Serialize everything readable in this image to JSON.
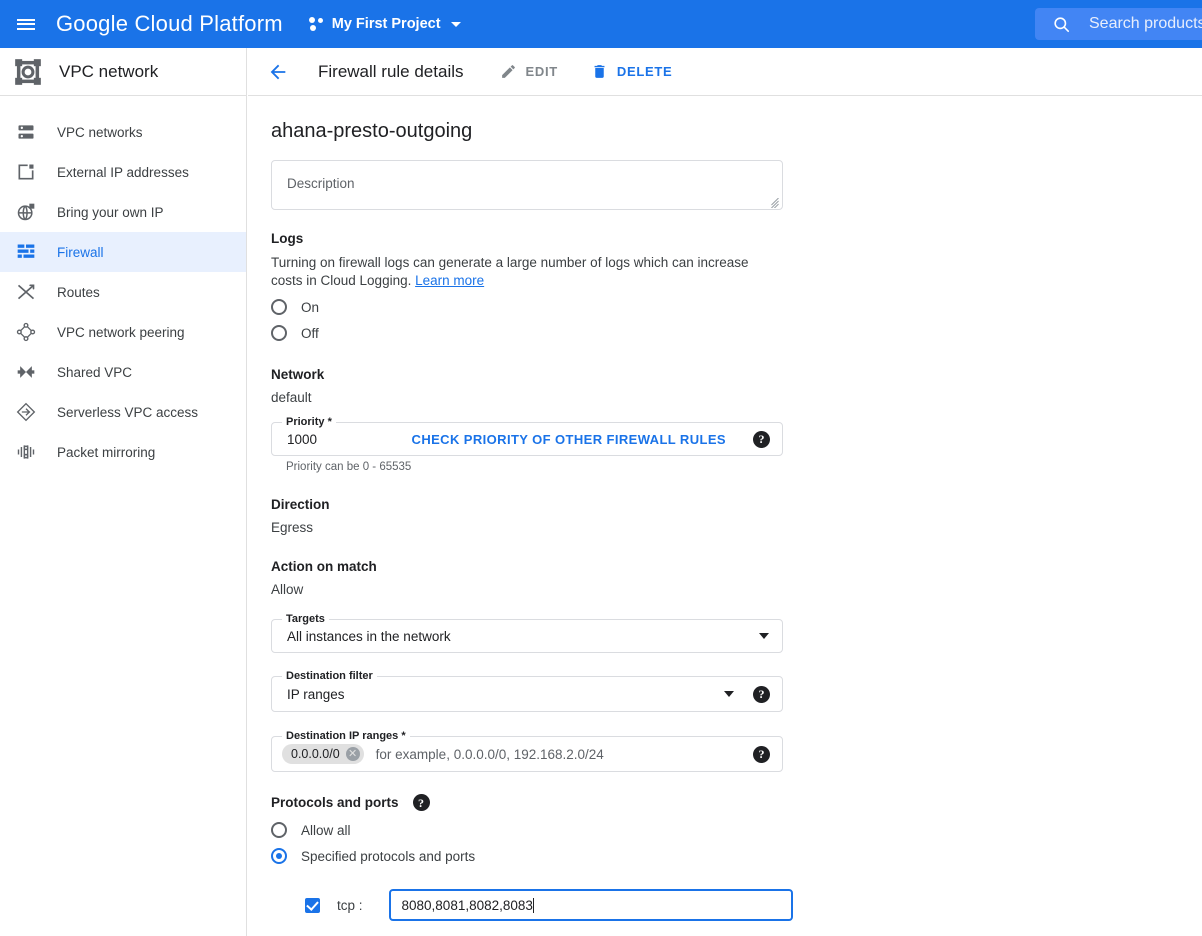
{
  "topbar": {
    "menu_icon": "hamburger-icon",
    "brand": "Google Cloud Platform",
    "project_icon": "project-dots-icon",
    "project_name": "My First Project",
    "project_caret": "chevron-down-icon",
    "search_icon": "search-icon",
    "search_placeholder": "Search products"
  },
  "sidebar": {
    "logo": "vpc-network-icon",
    "title": "VPC network",
    "items": [
      {
        "label": "VPC networks",
        "icon": "vpc-networks-icon",
        "active": false
      },
      {
        "label": "External IP addresses",
        "icon": "external-ip-icon",
        "active": false
      },
      {
        "label": "Bring your own IP",
        "icon": "bring-your-own-ip-icon",
        "active": false
      },
      {
        "label": "Firewall",
        "icon": "firewall-icon",
        "active": true
      },
      {
        "label": "Routes",
        "icon": "routes-icon",
        "active": false
      },
      {
        "label": "VPC network peering",
        "icon": "vpc-peering-icon",
        "active": false
      },
      {
        "label": "Shared VPC",
        "icon": "shared-vpc-icon",
        "active": false
      },
      {
        "label": "Serverless VPC access",
        "icon": "serverless-vpc-icon",
        "active": false
      },
      {
        "label": "Packet mirroring",
        "icon": "packet-mirroring-icon",
        "active": false
      }
    ]
  },
  "content_header": {
    "back_icon": "arrow-left-icon",
    "title": "Firewall rule details",
    "edit_icon": "pencil-icon",
    "edit_label": "EDIT",
    "delete_icon": "trash-icon",
    "delete_label": "DELETE"
  },
  "form": {
    "rule_name": "ahana-presto-outgoing",
    "description_placeholder": "Description",
    "logs": {
      "title": "Logs",
      "description_part1": "Turning on firewall logs can generate a large number of logs which can increase costs in Cloud Logging. ",
      "learn_more": "Learn more",
      "option_on": "On",
      "option_off": "Off",
      "selected": ""
    },
    "network": {
      "title": "Network",
      "value": "default"
    },
    "priority": {
      "legend": "Priority *",
      "value": "1000",
      "action_link": "CHECK PRIORITY OF OTHER FIREWALL RULES",
      "help_icon": "help-icon",
      "hint": "Priority can be 0 - 65535"
    },
    "direction": {
      "title": "Direction",
      "value": "Egress"
    },
    "action_on_match": {
      "title": "Action on match",
      "value": "Allow"
    },
    "targets": {
      "legend": "Targets",
      "value": "All instances in the network",
      "caret": "chevron-down-icon"
    },
    "destination_filter": {
      "legend": "Destination filter",
      "value": "IP ranges",
      "caret": "chevron-down-icon",
      "help_icon": "help-icon"
    },
    "destination_ip_ranges": {
      "legend": "Destination IP ranges *",
      "chips": [
        "0.0.0.0/0"
      ],
      "chip_remove_icon": "close-icon",
      "placeholder": "for example, 0.0.0.0/0, 192.168.2.0/24",
      "help_icon": "help-icon"
    },
    "protocols_and_ports": {
      "title": "Protocols and ports",
      "help_icon": "help-icon",
      "option_allow_all": "Allow all",
      "option_specified": "Specified protocols and ports",
      "selected": "specified",
      "tcp_label": "tcp :",
      "tcp_checked": true,
      "tcp_ports": "8080,8081,8082,8083"
    }
  },
  "colors": {
    "brand_blue": "#1a73e8",
    "search_blue": "#4285f4",
    "active_nav_bg": "#e8f0fe",
    "text_primary": "#202124",
    "text_secondary": "#5f6368",
    "border": "#dadce0"
  }
}
